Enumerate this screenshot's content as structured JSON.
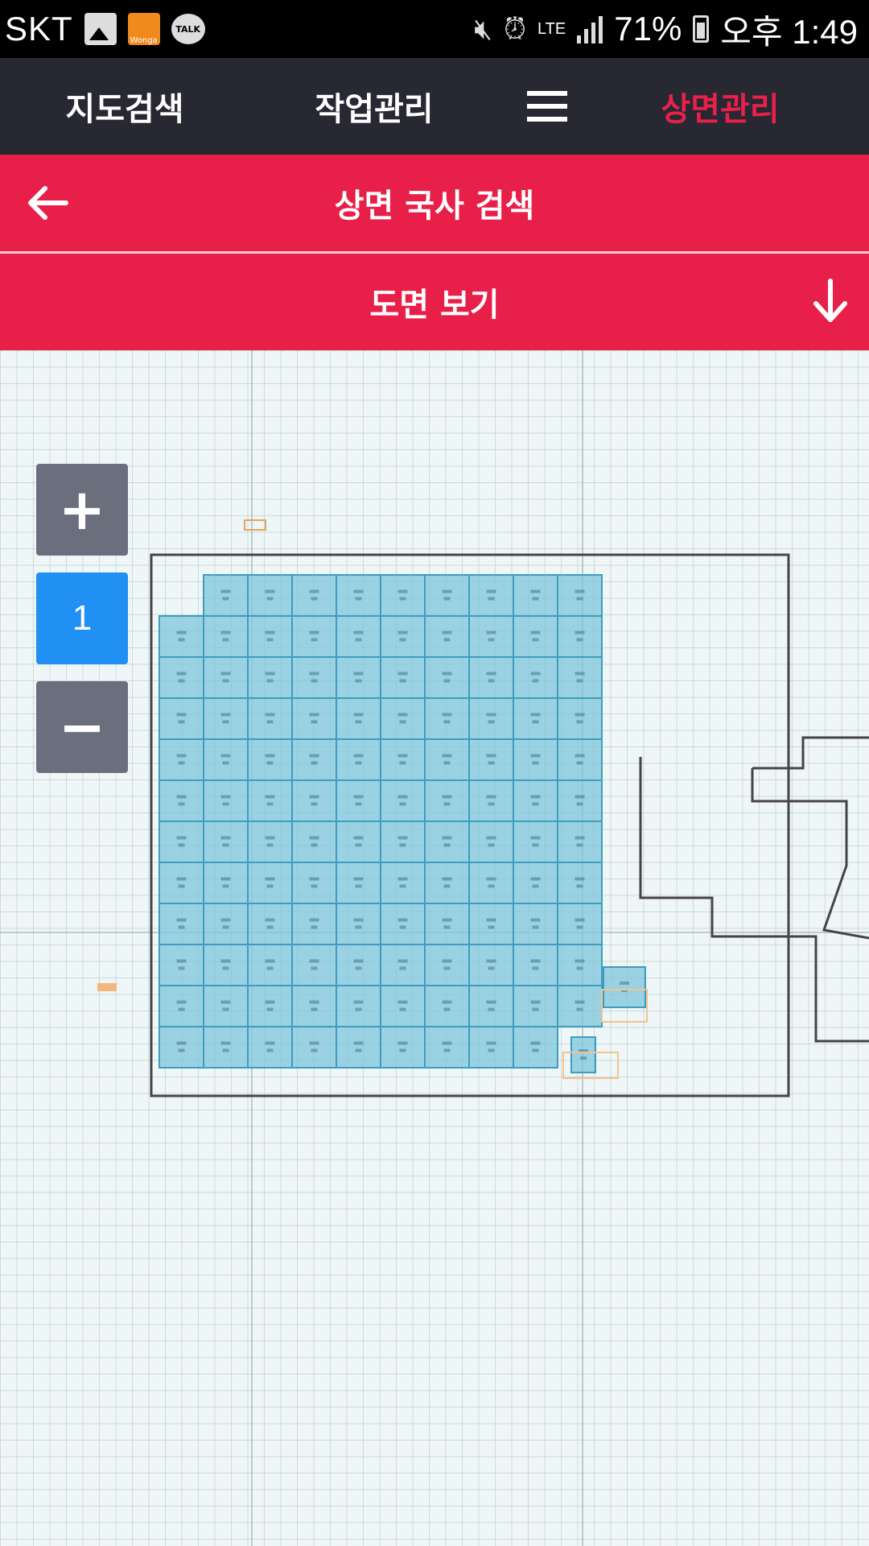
{
  "status_bar": {
    "carrier": "SKT",
    "talk_label": "TALK",
    "store_label": "Wonga",
    "network": "LTE",
    "battery": "71%",
    "time": "오후 1:49",
    "icons": [
      "gallery-icon",
      "store-icon",
      "kakaotalk-icon",
      "mute-icon",
      "alarm-icon",
      "signal-icon",
      "battery-icon"
    ]
  },
  "top_nav": {
    "items": [
      {
        "label": "지도검색"
      },
      {
        "label": "작업관리"
      },
      {
        "label": "상면관리"
      }
    ],
    "active_color": "#e8204a"
  },
  "subheader": {
    "title": "상면 국사 검색"
  },
  "drawing_bar": {
    "title": "도면 보기"
  },
  "zoom": {
    "in_label": "+",
    "level": "1",
    "out_label": "−"
  },
  "colors": {
    "accent_red": "#e81f49",
    "nav_bg": "#272832",
    "zoom_blue": "#2190f5",
    "zoom_gray": "#6b6e7c",
    "cell_blue": "#7fc6dc"
  }
}
